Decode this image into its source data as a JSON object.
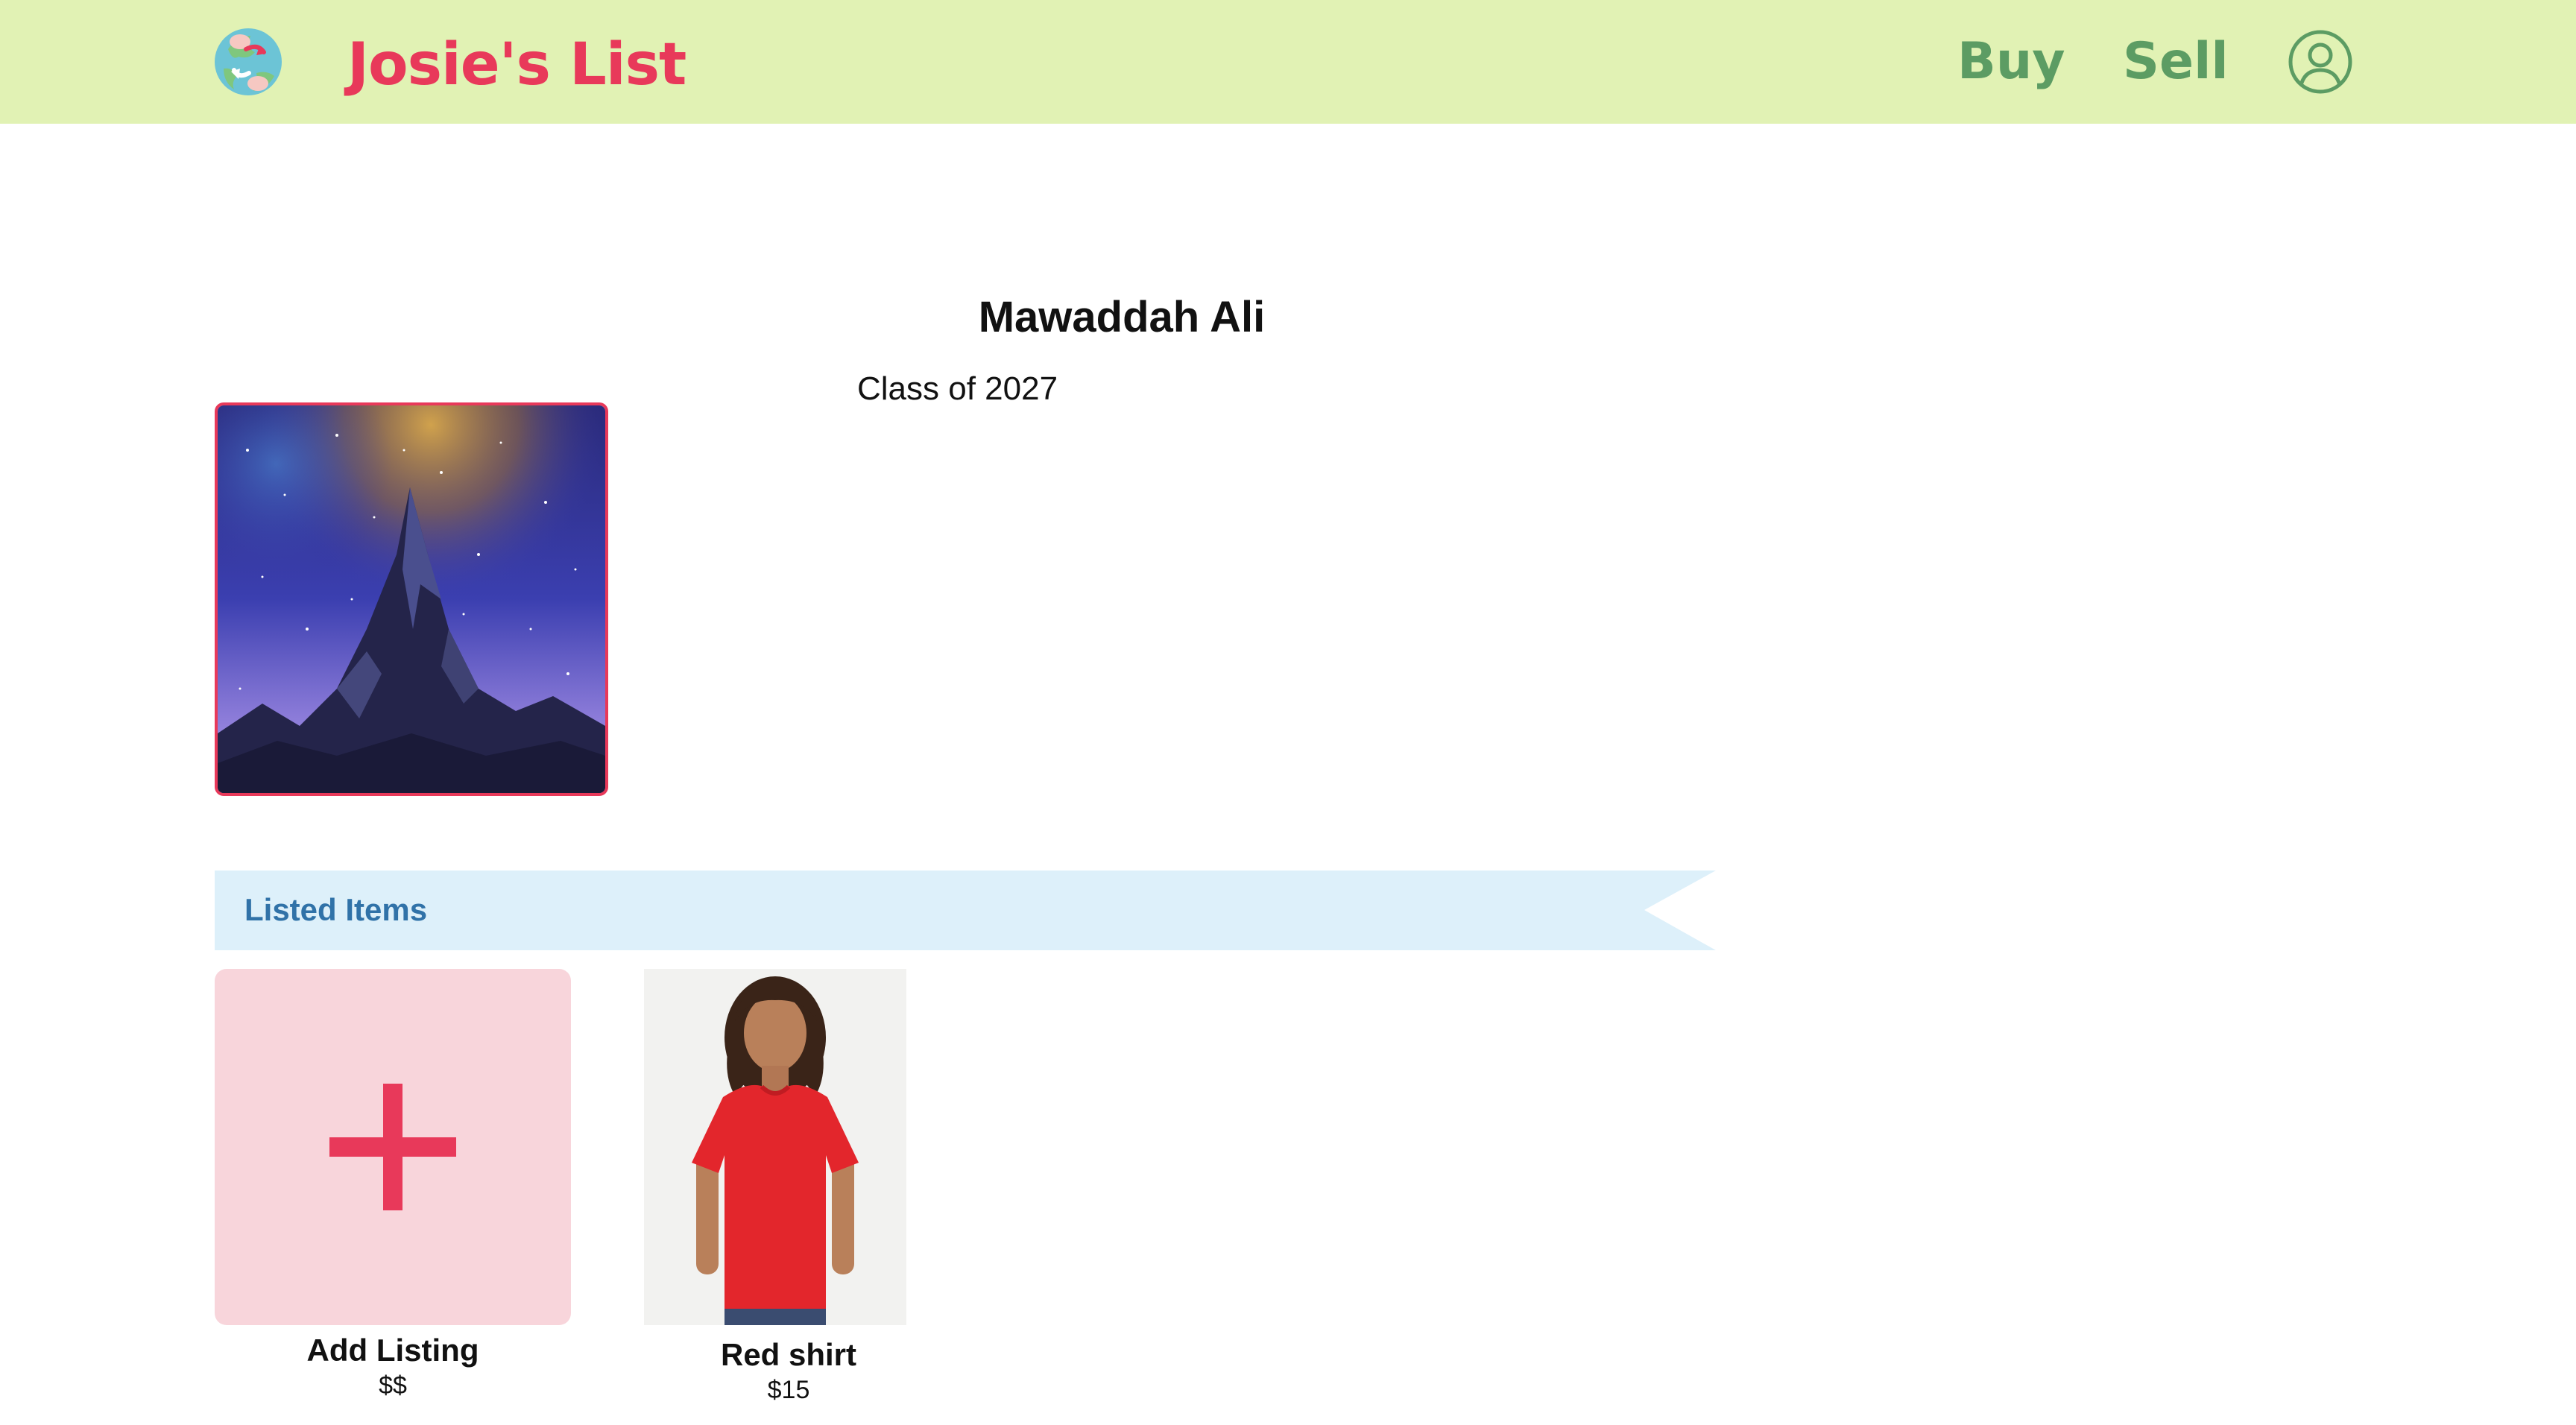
{
  "header": {
    "brand": "Josie's List",
    "nav": {
      "buy": "Buy",
      "sell": "Sell"
    },
    "logo_icon": "globe-recycle-icon",
    "profile_icon": "user-circle-icon"
  },
  "profile": {
    "name": "Mawaddah Ali",
    "class_year": "Class of 2027",
    "photo_icon": "mountain-night-sky-image"
  },
  "listings": {
    "section_title": "Listed Items",
    "add": {
      "title": "Add Listing",
      "price": "$$",
      "icon": "plus-icon"
    },
    "items": [
      {
        "title": "Red shirt",
        "price": "$15",
        "image": "red-shirt-photo"
      }
    ]
  },
  "colors": {
    "header_bg": "#e1f2b4",
    "brand": "#e8395a",
    "nav": "#5c9c63",
    "banner_bg": "#ddf0fa",
    "banner_text": "#3072a8",
    "add_card_bg": "#f8d5db",
    "accent_plus": "#e8395a"
  }
}
